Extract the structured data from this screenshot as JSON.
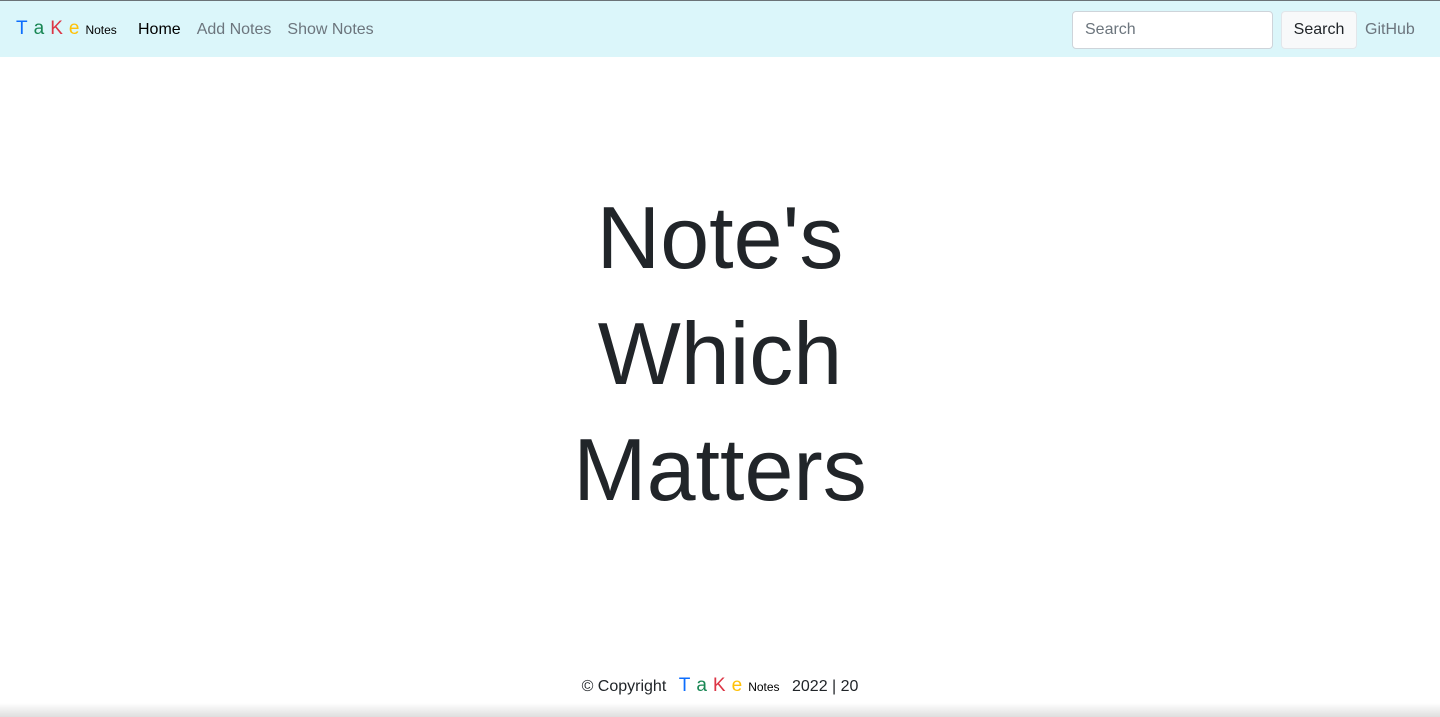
{
  "brand": {
    "letters": [
      {
        "char": "T",
        "color": "#0d6efd"
      },
      {
        "char": "a",
        "color": "#198754"
      },
      {
        "char": "K",
        "color": "#dc3545"
      },
      {
        "char": "e",
        "color": "#ffc107"
      }
    ],
    "suffix": "Notes"
  },
  "nav": {
    "items": [
      {
        "label": "Home",
        "active": true
      },
      {
        "label": "Add Notes",
        "active": false
      },
      {
        "label": "Show Notes",
        "active": false
      }
    ]
  },
  "search": {
    "placeholder": "Search",
    "value": "",
    "button_label": "Search"
  },
  "github_label": "GitHub",
  "hero": {
    "lines": [
      "Note's",
      "Which",
      "Matters"
    ]
  },
  "footer": {
    "prefix": "© Copyright",
    "suffix": "2022 | 20"
  },
  "colors": {
    "navbar_bg": "#dbf6fa",
    "text": "#212529",
    "muted": "#6c757d"
  }
}
